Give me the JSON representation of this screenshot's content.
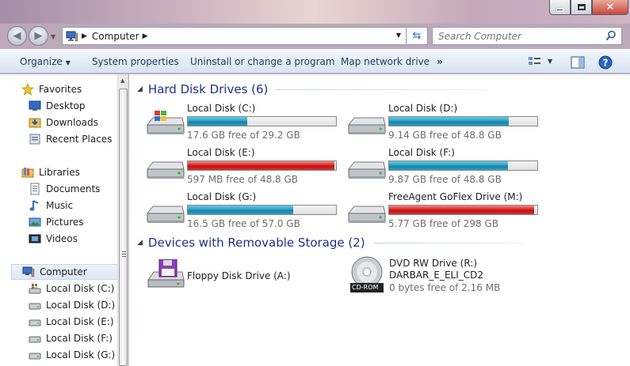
{
  "window": {
    "minimize_icon": "minimize-icon",
    "maximize_icon": "maximize-icon",
    "close_icon": "close-icon"
  },
  "address": {
    "location": "Computer",
    "search_placeholder": "Search Computer"
  },
  "toolbar": {
    "organize": "Organize",
    "system_properties": "System properties",
    "uninstall": "Uninstall or change a program",
    "map_network": "Map network drive",
    "more": "»"
  },
  "nav": {
    "favorites": "Favorites",
    "desktop": "Desktop",
    "downloads": "Downloads",
    "recent_places": "Recent Places",
    "libraries": "Libraries",
    "documents": "Documents",
    "music": "Music",
    "pictures": "Pictures",
    "videos": "Videos",
    "computer": "Computer",
    "drives": [
      "Local Disk (C:)",
      "Local Disk (D:)",
      "Local Disk (E:)",
      "Local Disk (F:)",
      "Local Disk (G:)"
    ]
  },
  "groups": {
    "hard_disks": "Hard Disk Drives (6)",
    "removable": "Devices with Removable Storage (2)"
  },
  "drives": [
    {
      "name": "Local Disk (C:)",
      "free": "17.6 GB free of 29.2 GB",
      "used_fraction": 0.4,
      "color": "#2aa3c8",
      "icon": "windows-drive-icon"
    },
    {
      "name": "Local Disk (D:)",
      "free": "9.14 GB free of 48.8 GB",
      "used_fraction": 0.81,
      "color": "#2aa3c8",
      "icon": "hard-drive-icon"
    },
    {
      "name": "Local Disk (E:)",
      "free": "597 MB free of 48.8 GB",
      "used_fraction": 0.99,
      "color": "#e02424",
      "icon": "hard-drive-icon"
    },
    {
      "name": "Local Disk (F:)",
      "free": "9.87 GB free of 48.8 GB",
      "used_fraction": 0.8,
      "color": "#2aa3c8",
      "icon": "hard-drive-icon"
    },
    {
      "name": "Local Disk (G:)",
      "free": "16.5 GB free of 57.0 GB",
      "used_fraction": 0.71,
      "color": "#2aa3c8",
      "icon": "hard-drive-icon"
    },
    {
      "name": "FreeAgent GoFlex Drive (M:)",
      "free": "5.77 GB free of 298 GB",
      "used_fraction": 0.98,
      "color": "#e02424",
      "icon": "hard-drive-icon"
    }
  ],
  "removable": {
    "floppy": "Floppy Disk Drive (A:)",
    "dvd_name": "DVD RW Drive (R:)",
    "dvd_label": "DARBAR_E_ELI_CD2",
    "dvd_free": "0 bytes free of 2.16 MB",
    "cdrom_badge": "CD-ROM"
  }
}
